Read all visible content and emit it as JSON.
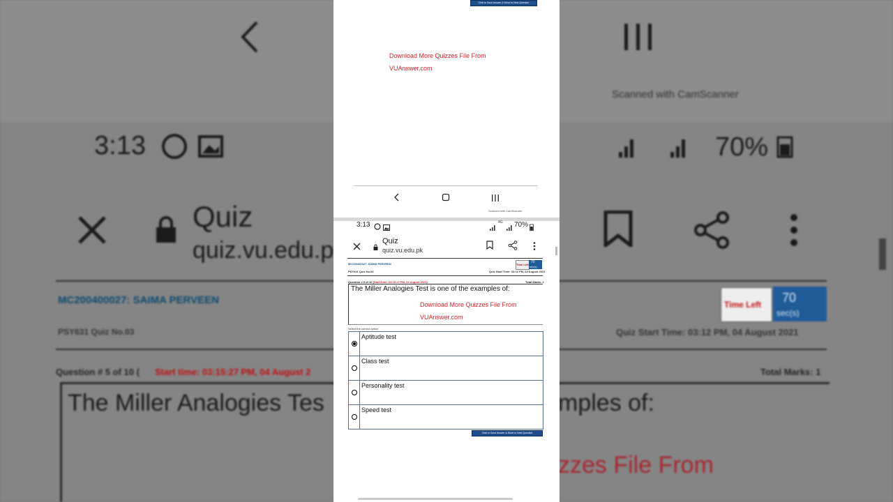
{
  "background": {
    "scanned_with": "Scanned with CamScanner",
    "status_time": "3:13",
    "battery": "70%",
    "browser_title": "Quiz",
    "browser_url": "quiz.vu.edu.pk",
    "student": "MC200400027: SAIMA PERVEEN",
    "quiz_name": "PSY631 Quiz No.03",
    "quiz_start": "Quiz Start Time: 03:12 PM, 04 August 2021",
    "question_header": "Question # 5 of 10 (",
    "question_start": "Start time: 03:15:27 PM, 04 August 2",
    "total_marks": "Total Marks: 1",
    "question_text": "The Miller Analogies Tes",
    "question_text_end": "mples of:",
    "download_fragment": "zzes File From",
    "time_left": "Time Left",
    "timer_value": "70",
    "timer_unit": "sec(s)"
  },
  "screenshot_top": {
    "next_button": "Click to Save Answer & Move to Next Question",
    "watermark_line1": "Download More Quizzes File From",
    "watermark_line2": "VUAnswer.com",
    "scanned_with": "Scanned with CamScanner"
  },
  "status_bar": {
    "time": "3:13",
    "network": "4G",
    "battery": "70%"
  },
  "browser": {
    "title": "Quiz",
    "url": "quiz.vu.edu.pk"
  },
  "quiz": {
    "student": "MC200400027: SAIMA PERVEEN",
    "quiz_name": "PSY631 Quiz No.03",
    "quiz_start": "Quiz Start Time: 03:12 PM, 04 August 2021",
    "time_left_label": "Time Left",
    "timer_value": "70",
    "timer_unit": "sec(s)",
    "question_label": "Question # 5 of 10 (",
    "question_start": "Start time: 03:15:27 PM, 04 August 2021",
    "question_close": ")",
    "total_marks": "Total Marks: 1",
    "question_text": "The Miller Analogies Test is one of the examples of:",
    "watermark_line1": "Download More Quizzes File From",
    "watermark_line2": "VUAnswer.com",
    "select_label": "Select the correct option",
    "options": [
      {
        "label": "Aptitude test",
        "selected": true
      },
      {
        "label": "Class test",
        "selected": false
      },
      {
        "label": "Personality test",
        "selected": false
      },
      {
        "label": "Speed test",
        "selected": false
      }
    ],
    "next_button": "Click to Save Answer & Move to Next Question"
  }
}
